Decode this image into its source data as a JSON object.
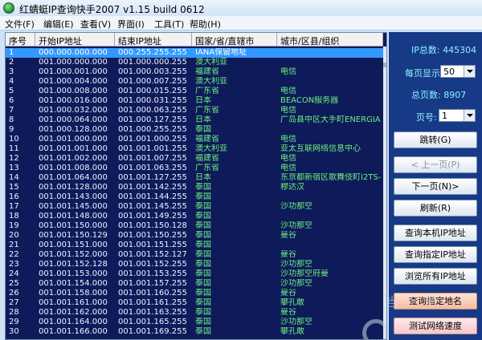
{
  "window": {
    "title": "红蜻蜓IP查询快手2007 v1.15 build 0612"
  },
  "menu": [
    "文件(F)",
    "编辑(E)",
    "查看(V)",
    "界面(I)",
    "工具(T)",
    "帮助(H)"
  ],
  "table": {
    "columns": [
      "序号",
      "开始IP地址",
      "结束IP地址",
      "国家/省/直辖市",
      "城市/区县/组织"
    ],
    "rows": [
      [
        "1",
        "000.000.000.000",
        "000.255.255.255",
        "IANA保留地址",
        ""
      ],
      [
        "2",
        "001.000.000.000",
        "001.000.000.255",
        "澳大利亚",
        ""
      ],
      [
        "3",
        "001.000.001.000",
        "001.000.003.255",
        "福建省",
        "电信"
      ],
      [
        "4",
        "001.000.004.000",
        "001.000.007.255",
        "澳大利亚",
        ""
      ],
      [
        "5",
        "001.000.008.000",
        "001.000.015.255",
        "广东省",
        "电信"
      ],
      [
        "6",
        "001.000.016.000",
        "001.000.031.255",
        "日本",
        "BEACON服务器"
      ],
      [
        "7",
        "001.000.032.000",
        "001.000.063.255",
        "广东省",
        "电信"
      ],
      [
        "8",
        "001.000.064.000",
        "001.000.127.255",
        "日本",
        "广岛县中区大手町ENERGIA"
      ],
      [
        "9",
        "001.000.128.000",
        "001.000.255.255",
        "泰国",
        ""
      ],
      [
        "10",
        "001.001.000.000",
        "001.001.000.255",
        "福建省",
        "电信"
      ],
      [
        "11",
        "001.001.001.000",
        "001.001.001.255",
        "澳大利亚",
        "亚太互联网络信息中心"
      ],
      [
        "12",
        "001.001.002.000",
        "001.001.007.255",
        "福建省",
        "电信"
      ],
      [
        "13",
        "001.001.008.000",
        "001.001.063.255",
        "广东省",
        "电信"
      ],
      [
        "14",
        "001.001.064.000",
        "001.001.127.255",
        "日本",
        "东京都新宿区歌舞伎町I2TS-"
      ],
      [
        "15",
        "001.001.128.000",
        "001.001.142.255",
        "泰国",
        "穆达汉"
      ],
      [
        "16",
        "001.001.143.000",
        "001.001.144.255",
        "泰国",
        ""
      ],
      [
        "17",
        "001.001.145.000",
        "001.001.145.255",
        "泰国",
        "沙功那空"
      ],
      [
        "18",
        "001.001.148.000",
        "001.001.149.255",
        "泰国",
        ""
      ],
      [
        "19",
        "001.001.150.000",
        "001.001.150.128",
        "泰国",
        "沙功那空"
      ],
      [
        "20",
        "001.001.150.129",
        "001.001.150.255",
        "泰国",
        "曼谷"
      ],
      [
        "21",
        "001.001.151.000",
        "001.001.151.255",
        "泰国",
        ""
      ],
      [
        "22",
        "001.001.152.000",
        "001.001.152.127",
        "泰国",
        "曼谷"
      ],
      [
        "23",
        "001.001.152.128",
        "001.001.152.255",
        "泰国",
        "沙功那空"
      ],
      [
        "24",
        "001.001.153.000",
        "001.001.153.255",
        "泰国",
        "沙功那空府曼"
      ],
      [
        "25",
        "001.001.154.000",
        "001.001.157.255",
        "泰国",
        "沙功那空"
      ],
      [
        "26",
        "001.001.158.000",
        "001.001.160.255",
        "泰国",
        "曼谷"
      ],
      [
        "27",
        "001.001.161.000",
        "001.001.161.255",
        "泰国",
        "攀孔敢"
      ],
      [
        "28",
        "001.001.162.000",
        "001.001.163.255",
        "泰国",
        "曼谷"
      ],
      [
        "29",
        "001.001.164.000",
        "001.001.165.255",
        "泰国",
        "沙功那空"
      ],
      [
        "30",
        "001.001.166.000",
        "001.001.169.255",
        "泰国",
        "攀孔敢"
      ]
    ],
    "selected_row": 1
  },
  "sidebar": {
    "ip_total": "IP总数: 445304",
    "per_page_label": "每页显示:",
    "per_page_value": "50",
    "page_total": "总页数: 8907",
    "page_label": "页号:",
    "page_value": "1",
    "buttons": {
      "jump": "跳转(G)",
      "prev": "< 上一页(P)",
      "next": "下一页(N)>",
      "refresh": "刷新(R)",
      "query_local": "查询本机IP地址",
      "query_specified": "查询指定IP地址",
      "browse_all": "浏览所有IP地址",
      "query_location": "查询指定地名",
      "test_speed": "测试网络速度"
    }
  },
  "watermark": {
    "text": "当 下 载"
  }
}
